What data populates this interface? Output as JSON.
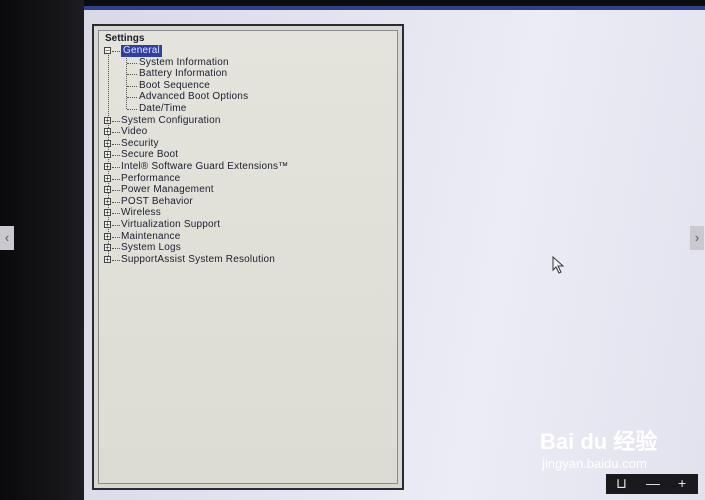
{
  "panel": {
    "title": "Settings"
  },
  "tree": {
    "root": {
      "label": "General",
      "expanded": true
    },
    "general_children": [
      "System Information",
      "Battery Information",
      "Boot Sequence",
      "Advanced Boot Options",
      "Date/Time"
    ],
    "categories": [
      "System Configuration",
      "Video",
      "Security",
      "Secure Boot",
      "Intel® Software Guard Extensions™",
      "Performance",
      "Power Management",
      "POST Behavior",
      "Wireless",
      "Virtualization Support",
      "Maintenance",
      "System Logs",
      "SupportAssist System Resolution"
    ]
  },
  "watermark": {
    "logo": "Bai du 经验",
    "url": "jingyan.baidu.com"
  },
  "viewer": {
    "prev_symbol": "‹",
    "next_symbol": "›",
    "toolbar": [
      "⊔",
      "—",
      "+"
    ]
  },
  "colors": {
    "selection": "#2f3fa0",
    "screen": "#e3e3ee",
    "panel": "#dcdcd4"
  }
}
